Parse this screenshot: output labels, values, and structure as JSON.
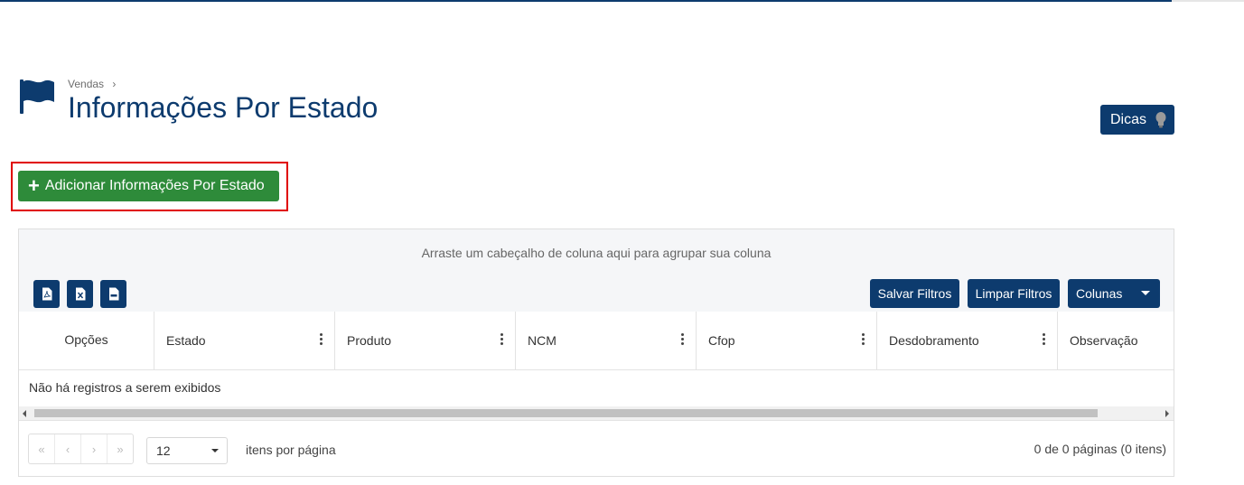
{
  "breadcrumb": {
    "parent": "Vendas",
    "separator": "›"
  },
  "page_title": "Informações Por Estado",
  "dicas_button": {
    "label": "Dicas",
    "icon": "lightbulb-icon"
  },
  "add_button": {
    "label": "Adicionar Informações Por Estado",
    "icon": "plus-icon"
  },
  "grid": {
    "group_hint": "Arraste um cabeçalho de coluna aqui para agrupar sua coluna",
    "export_buttons": [
      {
        "icon": "pdf-icon"
      },
      {
        "icon": "excel-icon"
      },
      {
        "icon": "csv-icon"
      }
    ],
    "toolbar": {
      "save_filters": "Salvar Filtros",
      "clear_filters": "Limpar Filtros",
      "columns": "Colunas"
    },
    "columns": [
      "Opções",
      "Estado",
      "Produto",
      "NCM",
      "Cfop",
      "Desdobramento",
      "Observação"
    ],
    "empty_message": "Não há registros a serem exibidos",
    "pager": {
      "page_size": "12",
      "per_page_label": "itens por página",
      "info": "0 de 0 páginas (0 itens)",
      "nav": [
        "«",
        "‹",
        "›",
        "»"
      ]
    }
  },
  "colors": {
    "primary": "#0d3b6e",
    "success": "#2e8b3a",
    "highlight": "#e00000"
  }
}
